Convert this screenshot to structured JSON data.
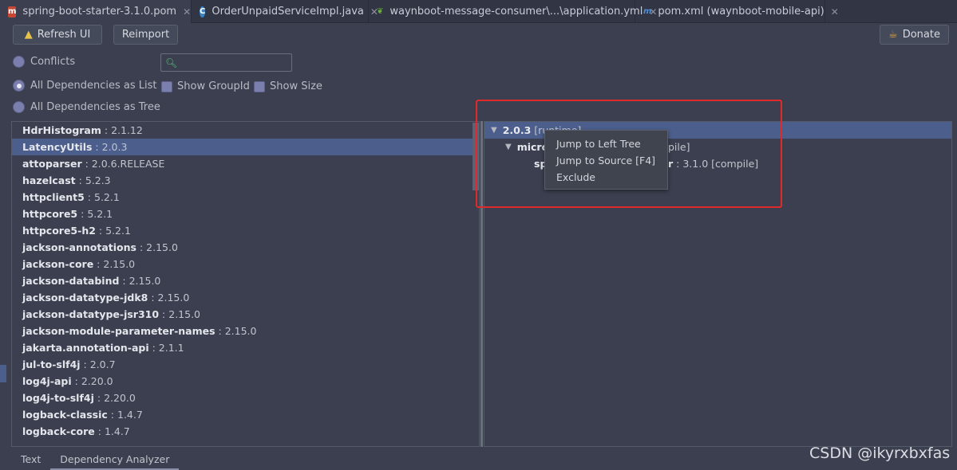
{
  "tabs": [
    {
      "label": "spring-boot-starter-3.1.0.pom",
      "icon": "maven-icon",
      "active": true
    },
    {
      "label": "OrderUnpaidServiceImpl.java",
      "icon": "java-class-icon",
      "active": false
    },
    {
      "label": "waynboot-message-consumer\\...\\application.yml",
      "icon": "spring-icon",
      "active": false
    },
    {
      "label": "pom.xml (waynboot-mobile-api)",
      "icon": "maven-m-icon",
      "active": false
    }
  ],
  "toolbar": {
    "refresh_label": "Refresh UI",
    "reimport_label": "Reimport",
    "donate_label": "Donate"
  },
  "options": {
    "conflicts": "Conflicts",
    "as_list": "All Dependencies as List",
    "as_tree": "All Dependencies as Tree",
    "show_groupid": "Show GroupId",
    "show_size": "Show Size",
    "search_placeholder": ""
  },
  "dependencies": [
    {
      "name": "HdrHistogram",
      "version": "2.1.12"
    },
    {
      "name": "LatencyUtils",
      "version": "2.0.3",
      "selected": true
    },
    {
      "name": "attoparser",
      "version": "2.0.6.RELEASE"
    },
    {
      "name": "hazelcast",
      "version": "5.2.3"
    },
    {
      "name": "httpclient5",
      "version": "5.2.1"
    },
    {
      "name": "httpcore5",
      "version": "5.2.1"
    },
    {
      "name": "httpcore5-h2",
      "version": "5.2.1"
    },
    {
      "name": "jackson-annotations",
      "version": "2.15.0"
    },
    {
      "name": "jackson-core",
      "version": "2.15.0"
    },
    {
      "name": "jackson-databind",
      "version": "2.15.0"
    },
    {
      "name": "jackson-datatype-jdk8",
      "version": "2.15.0"
    },
    {
      "name": "jackson-datatype-jsr310",
      "version": "2.15.0"
    },
    {
      "name": "jackson-module-parameter-names",
      "version": "2.15.0"
    },
    {
      "name": "jakarta.annotation-api",
      "version": "2.1.1"
    },
    {
      "name": "jul-to-slf4j",
      "version": "2.0.7"
    },
    {
      "name": "log4j-api",
      "version": "2.20.0"
    },
    {
      "name": "log4j-to-slf4j",
      "version": "2.20.0"
    },
    {
      "name": "logback-classic",
      "version": "1.4.7"
    },
    {
      "name": "logback-core",
      "version": "1.4.7"
    }
  ],
  "tree": {
    "root_version": "2.0.3",
    "root_scope": "[runtime]",
    "child_name": "micro",
    "child_scope": "pile]",
    "grandchild_name": "sp",
    "grandchild_tail": "r",
    "grandchild_version": ": 3.1.0 [compile]"
  },
  "context_menu": [
    "Jump to Left Tree",
    "Jump to Source [F4]",
    "Exclude"
  ],
  "bottom_tabs": [
    "Text",
    "Dependency Analyzer"
  ],
  "watermark": "CSDN @ikyrxbxfas",
  "colors": {
    "highlight": "#e02a2a",
    "selection": "#4b5e8c"
  }
}
